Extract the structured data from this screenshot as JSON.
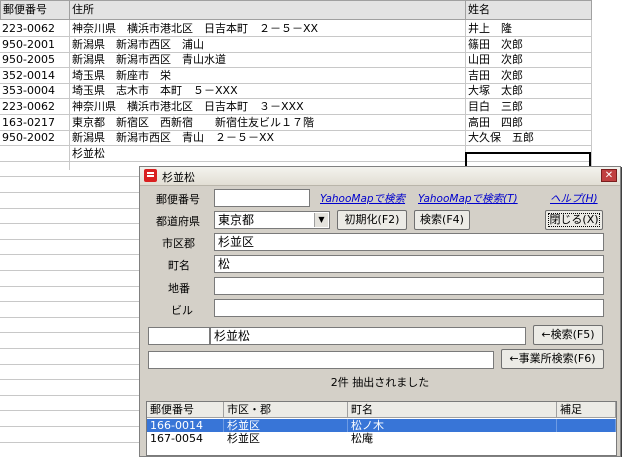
{
  "sheet": {
    "headers": [
      "郵便番号",
      "住所",
      "姓名"
    ],
    "rows": [
      {
        "zip": "223-0062",
        "address": "神奈川県　横浜市港北区　日吉本町　２－５－XX",
        "name": "井上　隆"
      },
      {
        "zip": "950-2001",
        "address": "新潟県　新潟市西区　浦山",
        "name": "篠田　次郎"
      },
      {
        "zip": "950-2005",
        "address": "新潟県　新潟市西区　青山水道",
        "name": "山田　次郎"
      },
      {
        "zip": "352-0014",
        "address": "埼玉県　新座市　栄",
        "name": "吉田　次郎"
      },
      {
        "zip": "353-0004",
        "address": "埼玉県　志木市　本町　５－XXX",
        "name": "大塚　太郎"
      },
      {
        "zip": "223-0062",
        "address": "神奈川県　横浜市港北区　日吉本町　３－XXX",
        "name": "目白　三郎"
      },
      {
        "zip": "163-0217",
        "address": "東京都　新宿区　西新宿　　新宿住友ビル１７階",
        "name": "高田　四郎"
      },
      {
        "zip": "950-2002",
        "address": "新潟県　新潟市西区　青山　２－５－XX",
        "name": "大久保　五郎"
      },
      {
        "zip": "",
        "address": "杉並松",
        "name": ""
      }
    ]
  },
  "dialog": {
    "title": "杉並松",
    "close_glyph": "✕",
    "labels": {
      "zip": "郵便番号",
      "prefecture": "都道府県",
      "city": "市区郡",
      "town": "町名",
      "block": "地番",
      "building": "ビル"
    },
    "fields": {
      "zip": "",
      "prefecture": "東京都",
      "city": "杉並区",
      "town": "松",
      "block": "",
      "building": ""
    },
    "links": {
      "yahoo_map_search": "YahooMapで検索",
      "yahoo_map_search_t": "YahooMapで検索(T)",
      "help": "ヘルプ(H)"
    },
    "buttons": {
      "initialize": "初期化(F2)",
      "search": "検索(F4)",
      "close": "閉じる(X)",
      "search_back": "←検索(F5)",
      "office_search": "←事業所検索(F6)"
    },
    "search_input_left": "",
    "search_input_main": "杉並松",
    "office_input": "",
    "status": "2件 抽出されました",
    "results": {
      "columns": [
        "郵便番号",
        "市区・郡",
        "町名",
        "補足"
      ],
      "rows": [
        {
          "zip": "166-0014",
          "city": "杉並区",
          "town": "松ノ木",
          "note": "",
          "selected": true
        },
        {
          "zip": "167-0054",
          "city": "杉並区",
          "town": "松庵",
          "note": "",
          "selected": false
        }
      ]
    }
  }
}
